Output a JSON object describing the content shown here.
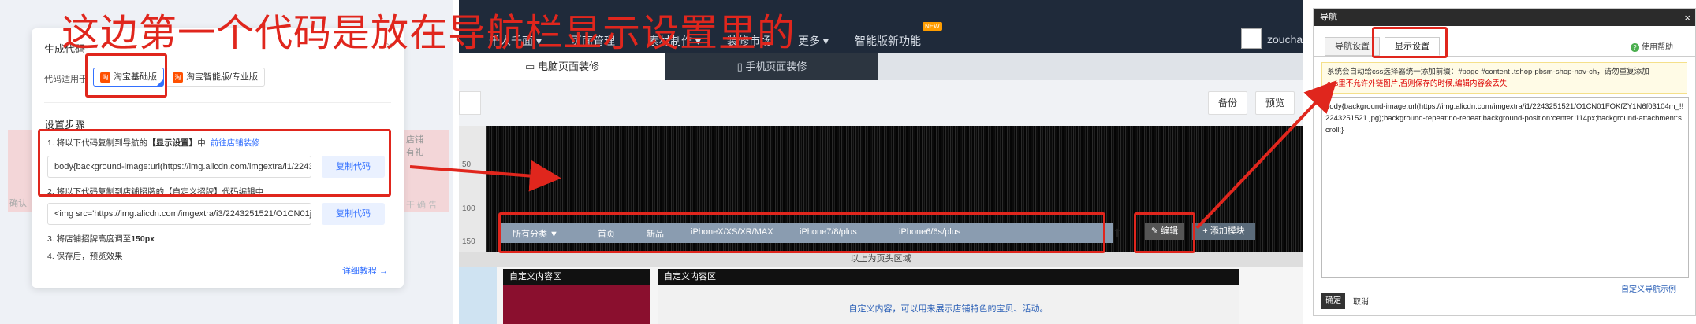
{
  "annotation": {
    "caption": "这边第一个代码是放在导航栏显示设置里的",
    "color": "#e0261d"
  },
  "panel1": {
    "edge_left": "确认",
    "edge_right_top": "店铺\n有礼",
    "edge_right_bottom": "干 确 告",
    "dialog": {
      "title": "生成代码",
      "close": "×",
      "apply_label": "代码适用于",
      "versions": [
        "淘宝基础版",
        "淘宝智能版/专业版"
      ],
      "version_icon": "淘",
      "steps_title": "设置步骤",
      "step1_prefix": "1. 将以下代码复制到导航的",
      "step1_bold": "【显示设置】",
      "step1_mid": "中",
      "step1_link": "前往店铺装修",
      "code1": "body{background-image:url(https://img.alicdn.com/imgextra/i1/224325",
      "copy_label": "复制代码",
      "step2": "2. 将以下代码复制到店铺招牌的【自定义招牌】代码编辑中",
      "code2": "<img src='https://img.alicdn.com/imgextra/i3/2243251521/O1CN01jl2llv",
      "step3_prefix": "3. 将店铺招牌高度调至",
      "step3_bold": "150px",
      "step4": "4. 保存后，预览效果",
      "tutorial": "详细教程 →"
    }
  },
  "panel2": {
    "nav_items": [
      "千人千面 ▾",
      "页面管理",
      "素材制作 ▾",
      "装修市场",
      "更多 ▾",
      "智能版新功能"
    ],
    "new_badge": "NEW",
    "username": "zoucha",
    "tabs": [
      "电脑页面装修",
      "手机页面装修"
    ],
    "toolbar": [
      "备份",
      "预览"
    ],
    "ruler": [
      "50",
      "100",
      "150"
    ],
    "shop_nav": [
      "所有分类 ▼",
      "首页",
      "新品",
      "iPhoneX/XS/XR/MAX",
      "iPhone7/8/plus",
      "iPhone6/6s/plus"
    ],
    "up_arrow": "⬆",
    "edit_label": "✎ 编辑",
    "add_label": "+ 添加模块",
    "divider": "以上为页头区域",
    "custom1_title": "自定义内容区",
    "custom2_title": "自定义内容区",
    "custom2_text": "自定义内容，可以用来展示店铺特色的宝贝、活动。"
  },
  "panel3": {
    "title": "导航",
    "close": "×",
    "tabs": [
      "导航设置",
      "显示设置"
    ],
    "help": "使用帮助",
    "help_icon": "?",
    "notice_line1": "系统会自动给css选择器统一添加前缀：#page #content .tshop-pbsm-shop-nav-ch，请勿重复添加",
    "notice_line2": "css里不允许外链图片,否则保存的时候,编辑内容会丢失",
    "css_text": "body{background-image:url(https://img.alicdn.com/imgextra/i1/2243251521/O1CN01FOKfZY1N6f03104m_!!2243251521.jpg);background-repeat:no-repeat;background-position:center 114px;background-attachment:scroll;}",
    "link": "自定义导航示例",
    "ok": "确定",
    "cancel": "取消"
  }
}
